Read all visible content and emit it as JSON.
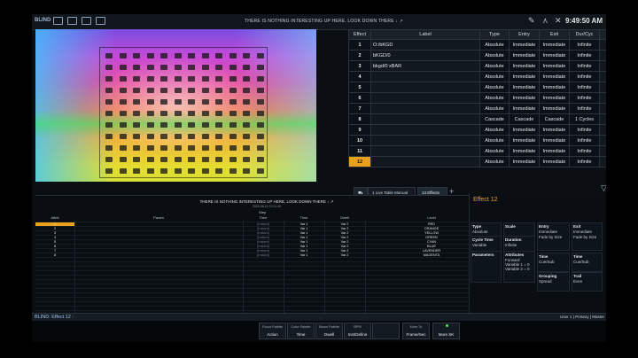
{
  "topbar": {
    "blind_label": "BLIND",
    "message": "THERE IS NOTHING INTERESTING UP HERE.  LOOK DOWN THERE ↓ ↗",
    "clock": "9:49:50 AM"
  },
  "effect_list": {
    "headers": [
      "Effect",
      "Label",
      "Type",
      "Entry",
      "Exit",
      "Dur/Cyc",
      "Scale"
    ],
    "rows": [
      {
        "num": "1",
        "label": "O:/bKGD",
        "type": "Absolute",
        "entry": "Immediate",
        "exit": "Immediate",
        "dur": "Infinite",
        "scale": ""
      },
      {
        "num": "2",
        "label": "bKGD/0",
        "type": "Absolute",
        "entry": "Immediate",
        "exit": "Immediate",
        "dur": "Infinite",
        "scale": ""
      },
      {
        "num": "3",
        "label": "bkgd/0 xBAR",
        "type": "Absolute",
        "entry": "Immediate",
        "exit": "Immediate",
        "dur": "Infinite",
        "scale": ""
      },
      {
        "num": "4",
        "label": "",
        "type": "Absolute",
        "entry": "Immediate",
        "exit": "Immediate",
        "dur": "Infinite",
        "scale": ""
      },
      {
        "num": "5",
        "label": "",
        "type": "Absolute",
        "entry": "Immediate",
        "exit": "Immediate",
        "dur": "Infinite",
        "scale": ""
      },
      {
        "num": "6",
        "label": "",
        "type": "Absolute",
        "entry": "Immediate",
        "exit": "Immediate",
        "dur": "Infinite",
        "scale": ""
      },
      {
        "num": "7",
        "label": "",
        "type": "Absolute",
        "entry": "Immediate",
        "exit": "Immediate",
        "dur": "Infinite",
        "scale": ""
      },
      {
        "num": "8",
        "label": "",
        "type": "Cascade",
        "entry": "Cascade",
        "exit": "Cascade",
        "dur": "1 Cycles",
        "scale": ""
      },
      {
        "num": "9",
        "label": "",
        "type": "Absolute",
        "entry": "Immediate",
        "exit": "Immediate",
        "dur": "Infinite",
        "scale": ""
      },
      {
        "num": "10",
        "label": "",
        "type": "Absolute",
        "entry": "Immediate",
        "exit": "Immediate",
        "dur": "Infinite",
        "scale": ""
      },
      {
        "num": "11",
        "label": "",
        "type": "Absolute",
        "entry": "Immediate",
        "exit": "Immediate",
        "dur": "Infinite",
        "scale": ""
      },
      {
        "num": "12",
        "label": "",
        "type": "Absolute",
        "entry": "Immediate",
        "exit": "Immediate",
        "dur": "Infinite",
        "scale": ""
      }
    ],
    "selected_row": "12"
  },
  "tabs": {
    "tab1": "1 Live Table Manual",
    "tab2": "13 Effects",
    "add": "+"
  },
  "grid": {
    "message": "THERE IS NOTHING INTERESTING UP HERE.  LOOK DOWN THERE ↓ ↗",
    "subline": "2020-06-11 07:01:40",
    "step_header": "Step",
    "headers": [
      "Attrib",
      "Param",
      "Time",
      "Time",
      "Dwell",
      "Level"
    ],
    "rows": [
      {
        "n": "1",
        "t1": "(Instant)",
        "t2": "Var 1",
        "dw": "Var 2",
        "lv": "RED"
      },
      {
        "n": "2",
        "t1": "(Instant)",
        "t2": "Var 1",
        "dw": "Var 2",
        "lv": "ORANGE"
      },
      {
        "n": "3",
        "t1": "(Instant)",
        "t2": "Var 1",
        "dw": "Var 2",
        "lv": "YELLOW"
      },
      {
        "n": "4",
        "t1": "(Instant)",
        "t2": "Var 1",
        "dw": "Var 2",
        "lv": "GREEN"
      },
      {
        "n": "5",
        "t1": "(Instant)",
        "t2": "Var 1",
        "dw": "Var 2",
        "lv": "CYAN"
      },
      {
        "n": "6",
        "t1": "(Instant)",
        "t2": "Var 1",
        "dw": "Var 2",
        "lv": "BLUE"
      },
      {
        "n": "7",
        "t1": "(Instant)",
        "t2": "Var 1",
        "dw": "Var 2",
        "lv": "LAVENDER"
      },
      {
        "n": "8",
        "t1": "(Instant)",
        "t2": "Var 1",
        "dw": "Var 2",
        "lv": "MAGENTA"
      }
    ]
  },
  "info": {
    "title": "Effect  12",
    "type_label": "Type",
    "type_val": "Absolute",
    "scale_label": "Scale",
    "entry_label": "Entry",
    "entry_val1": "Immediate",
    "entry_val2": "Fade by Size",
    "exit_label": "Exit",
    "exit_val1": "Immediate",
    "exit_val2": "Fade by Size",
    "cycle_label": "Cycle Time",
    "cycle_val": "Variable",
    "duration_label": "Duration",
    "duration_val": "Infinite",
    "params_label": "Parameters",
    "attr_label": "Attributes",
    "attr_val1": "Forward",
    "attr_val2": "Variable 1 = 0",
    "attr_val3": "Variable 2 = 0",
    "time_label": "Time",
    "time_val": "Cue/Sub",
    "time2_label": "Time",
    "time2_val": "Cue/Sub",
    "grouping_label": "Grouping",
    "grouping_val": "Spread",
    "trail_label": "Trail",
    "trail_val": "Even"
  },
  "command_line": {
    "text": "BLIND: Effect  12 :",
    "user": "User 1 | Primary | Master"
  },
  "softkeys": [
    {
      "top": "Focus Palette",
      "bottom": "Action"
    },
    {
      "top": "Color Palette",
      "bottom": "Time"
    },
    {
      "top": "Beam Palette",
      "bottom": "Dwell"
    },
    {
      "top": "BPM",
      "bottom": "Inst/Define"
    },
    {
      "top": "",
      "bottom": ""
    },
    {
      "top": "More To",
      "bottom": "Frame/Sec"
    },
    {
      "top": "",
      "bottom": "More SK"
    }
  ],
  "colors": {
    "accent": "#e9a11d",
    "panel_bg": "#0b0f14",
    "cmd_text": "#9ec4f0"
  }
}
